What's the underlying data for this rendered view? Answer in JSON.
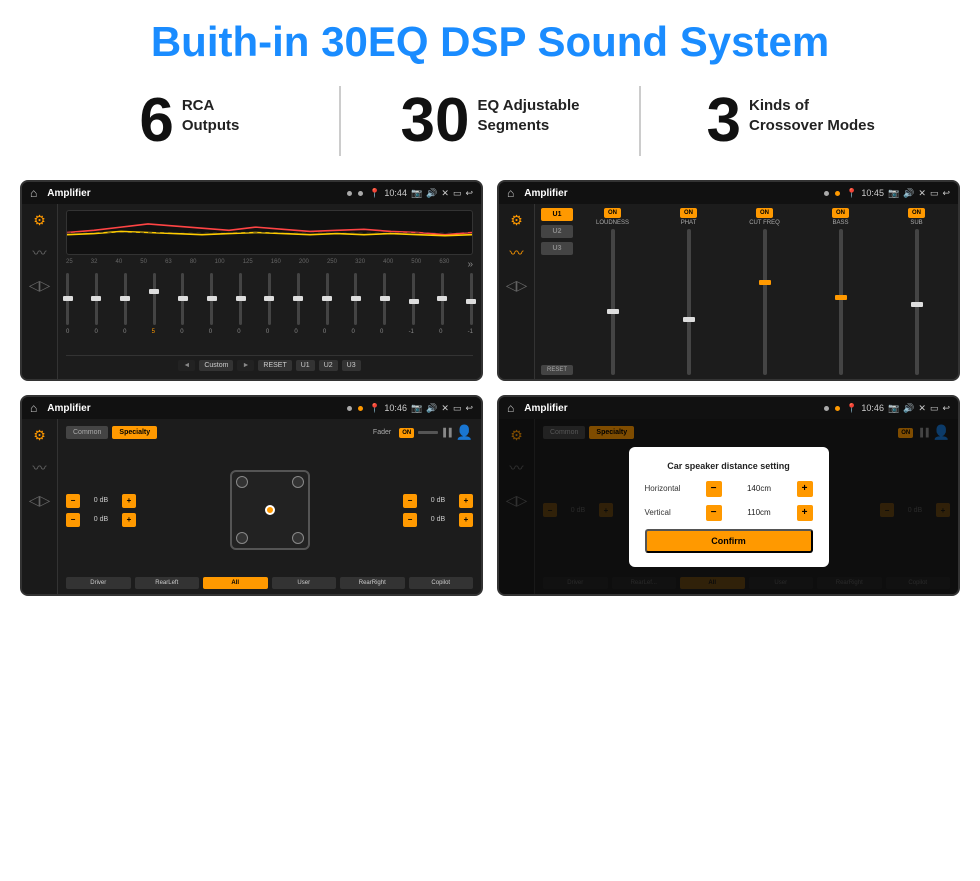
{
  "header": {
    "title": "Buith-in 30EQ DSP Sound System"
  },
  "stats": [
    {
      "number": "6",
      "text": "RCA\nOutputs"
    },
    {
      "number": "30",
      "text": "EQ Adjustable\nSegments"
    },
    {
      "number": "3",
      "text": "Kinds of\nCrossover Modes"
    }
  ],
  "screens": {
    "screen1": {
      "status_title": "Amplifier",
      "time": "10:44",
      "eq_freqs": [
        "25",
        "32",
        "40",
        "50",
        "63",
        "80",
        "100",
        "125",
        "160",
        "200",
        "250",
        "320",
        "400",
        "500",
        "630"
      ],
      "eq_values": [
        "0",
        "0",
        "0",
        "5",
        "0",
        "0",
        "0",
        "0",
        "0",
        "0",
        "0",
        "0",
        "-1",
        "0",
        "-1"
      ],
      "bottom_btns": [
        "Custom",
        "RESET",
        "U1",
        "U2",
        "U3"
      ]
    },
    "screen2": {
      "status_title": "Amplifier",
      "time": "10:45",
      "channels": [
        "U1",
        "U2",
        "U3"
      ],
      "labels": [
        "LOUDNESS",
        "PHAT",
        "CUT FREQ",
        "BASS",
        "SUB"
      ],
      "reset": "RESET"
    },
    "screen3": {
      "status_title": "Amplifier",
      "time": "10:46",
      "tabs": [
        "Common",
        "Specialty"
      ],
      "fader_label": "Fader",
      "fader_on": "ON",
      "bottom_btns": [
        "Driver",
        "RearLeft",
        "All",
        "User",
        "RearRight",
        "Copilot"
      ],
      "db_values": [
        "0 dB",
        "0 dB",
        "0 dB",
        "0 dB"
      ]
    },
    "screen4": {
      "status_title": "Amplifier",
      "time": "10:46",
      "tabs": [
        "Common",
        "Specialty"
      ],
      "dialog": {
        "title": "Car speaker distance setting",
        "fields": [
          {
            "label": "Horizontal",
            "value": "140cm"
          },
          {
            "label": "Vertical",
            "value": "110cm"
          }
        ],
        "confirm": "Confirm"
      },
      "bottom_btns": [
        "Driver",
        "RearLef...",
        "All",
        "User",
        "RearRight",
        "Copilot"
      ],
      "db_values": [
        "0 dB",
        "0 dB"
      ]
    }
  }
}
